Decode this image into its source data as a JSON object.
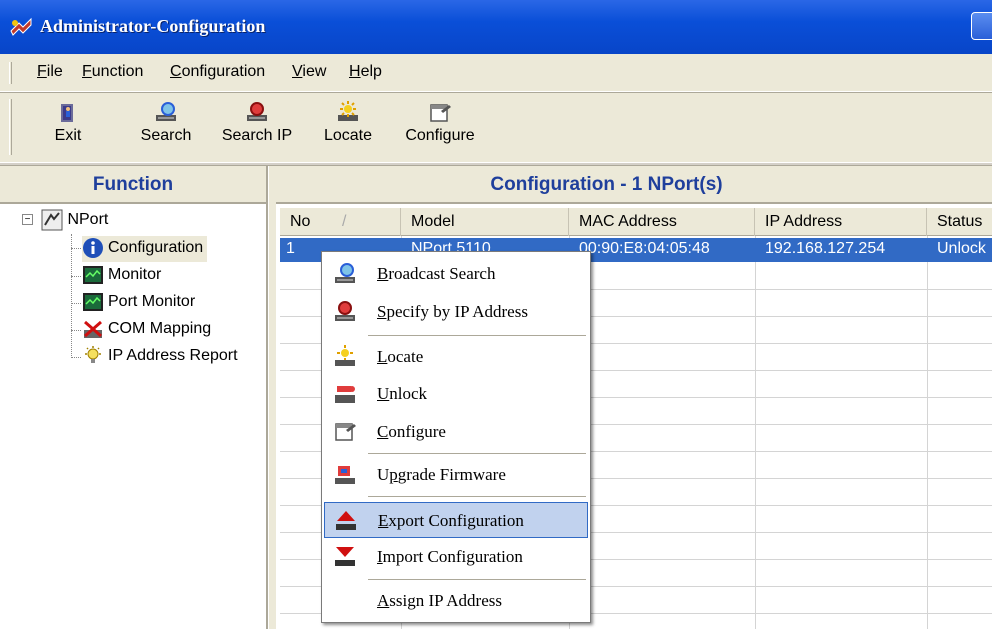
{
  "window": {
    "title": "Administrator-Configuration"
  },
  "menubar": {
    "items": [
      {
        "label": "File",
        "key": "F",
        "rest": "ile"
      },
      {
        "label": "Function",
        "key": "F",
        "rest": "unction"
      },
      {
        "label": "Configuration",
        "key": "C",
        "rest": "onfiguration"
      },
      {
        "label": "View",
        "key": "V",
        "rest": "iew"
      },
      {
        "label": "Help",
        "key": "H",
        "rest": "elp"
      }
    ]
  },
  "toolbar": {
    "exit_label": "Exit",
    "search_label": "Search",
    "search_ip_label": "Search IP",
    "locate_label": "Locate",
    "configure_label": "Configure"
  },
  "left": {
    "header": "Function",
    "tree": {
      "root": "NPort",
      "children": [
        "Configuration",
        "Monitor",
        "Port Monitor",
        "COM Mapping",
        "IP Address Report"
      ]
    }
  },
  "right": {
    "header": "Configuration - 1 NPort(s)",
    "columns": [
      "No",
      "Model",
      "MAC Address",
      "IP Address",
      "Status"
    ],
    "sort_indicator": "/",
    "rows": [
      {
        "no": "1",
        "model": "NPort 5110",
        "mac": "00:90:E8:04:05:48",
        "ip": "192.168.127.254",
        "status": "Unlock"
      }
    ]
  },
  "context_menu": {
    "items": [
      {
        "label": "Broadcast Search",
        "icon": "broadcast-search-icon"
      },
      {
        "label": "Specify by IP Address",
        "icon": "specify-ip-icon"
      },
      {
        "label": "Locate",
        "icon": "locate-icon"
      },
      {
        "label": "Unlock",
        "icon": "unlock-icon"
      },
      {
        "label": "Configure",
        "icon": "configure-icon"
      },
      {
        "label": "Upgrade Firmware",
        "icon": "upgrade-firmware-icon"
      },
      {
        "label": "Export Configuration",
        "icon": "export-config-icon"
      },
      {
        "label": "Import Configuration",
        "icon": "import-config-icon"
      },
      {
        "label": "Assign IP Address",
        "icon": ""
      }
    ],
    "highlighted": "Export Configuration"
  },
  "colors": {
    "title_blue": "#0a4fd8",
    "header_text": "#1f3f9c",
    "selection": "#316ac5",
    "menu_highlight": "#c1d2ee"
  }
}
